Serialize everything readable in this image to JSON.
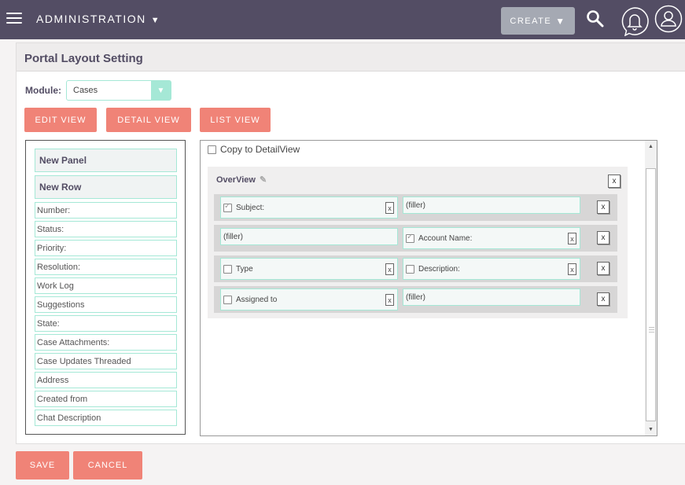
{
  "nav": {
    "title": "ADMINISTRATION",
    "caret": "▼",
    "create_label": "CREATE",
    "create_caret": "▼"
  },
  "page": {
    "header": "Portal Layout Setting",
    "module_label": "Module:",
    "module_value": "Cases",
    "views": [
      "EDIT VIEW",
      "DETAIL VIEW",
      "LIST VIEW"
    ]
  },
  "fieldlist": {
    "new_panel": "New Panel",
    "new_row": "New Row",
    "fields": [
      "Number:",
      "Status:",
      "Priority:",
      "Resolution:",
      "Work Log",
      "Suggestions",
      "State:",
      "Case Attachments:",
      "Case Updates Threaded",
      "Address",
      "Created from",
      "Chat Description"
    ]
  },
  "layout": {
    "copy_label": "Copy to DetailView",
    "copy_checked": false,
    "panel_title": "OverView",
    "remove_label": "x",
    "rows": [
      {
        "left": {
          "label": "Subject:",
          "checkbox": true,
          "checked": true,
          "removable": true
        },
        "right": {
          "label": "(filler)",
          "checkbox": false,
          "removable": false
        }
      },
      {
        "left": {
          "label": "(filler)",
          "checkbox": false,
          "removable": false
        },
        "right": {
          "label": "Account Name:",
          "checkbox": true,
          "checked": true,
          "removable": true
        }
      },
      {
        "left": {
          "label": "Type",
          "checkbox": true,
          "checked": false,
          "removable": true
        },
        "right": {
          "label": "Description:",
          "checkbox": true,
          "checked": false,
          "removable": true
        }
      },
      {
        "left": {
          "label": "Assigned to",
          "checkbox": true,
          "checked": false,
          "removable": true
        },
        "right": {
          "label": "(filler)",
          "checkbox": false,
          "removable": false
        }
      }
    ]
  },
  "footer": {
    "save_label": "SAVE",
    "cancel_label": "CANCEL"
  },
  "colors": {
    "nav_bg": "#534d64",
    "accent_button": "#f08377",
    "field_border": "#a5e8d6",
    "create_bg": "#a5a9b3"
  }
}
